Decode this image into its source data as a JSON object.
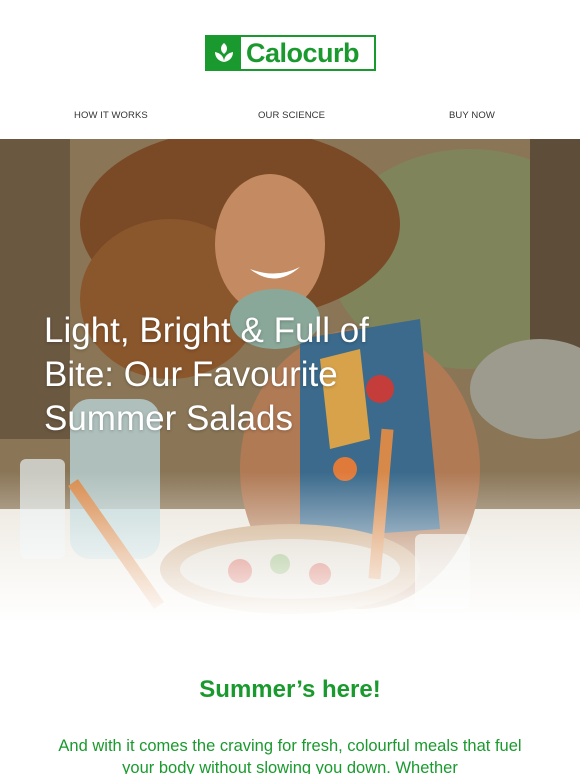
{
  "brand": {
    "name": "Calocurb",
    "color": "#1a9a2e"
  },
  "nav": [
    {
      "label": "HOW IT WORKS"
    },
    {
      "label": "OUR SCIENCE"
    },
    {
      "label": "BUY NOW"
    }
  ],
  "hero": {
    "title": "Light, Bright & Full of Bite: Our Favourite Summer Salads",
    "image_icon": "woman-with-salad-photo"
  },
  "intro": {
    "heading": "Summer’s here!",
    "body": "And with it comes the craving for fresh, colourful meals that fuel your body without slowing you down. Whether"
  }
}
